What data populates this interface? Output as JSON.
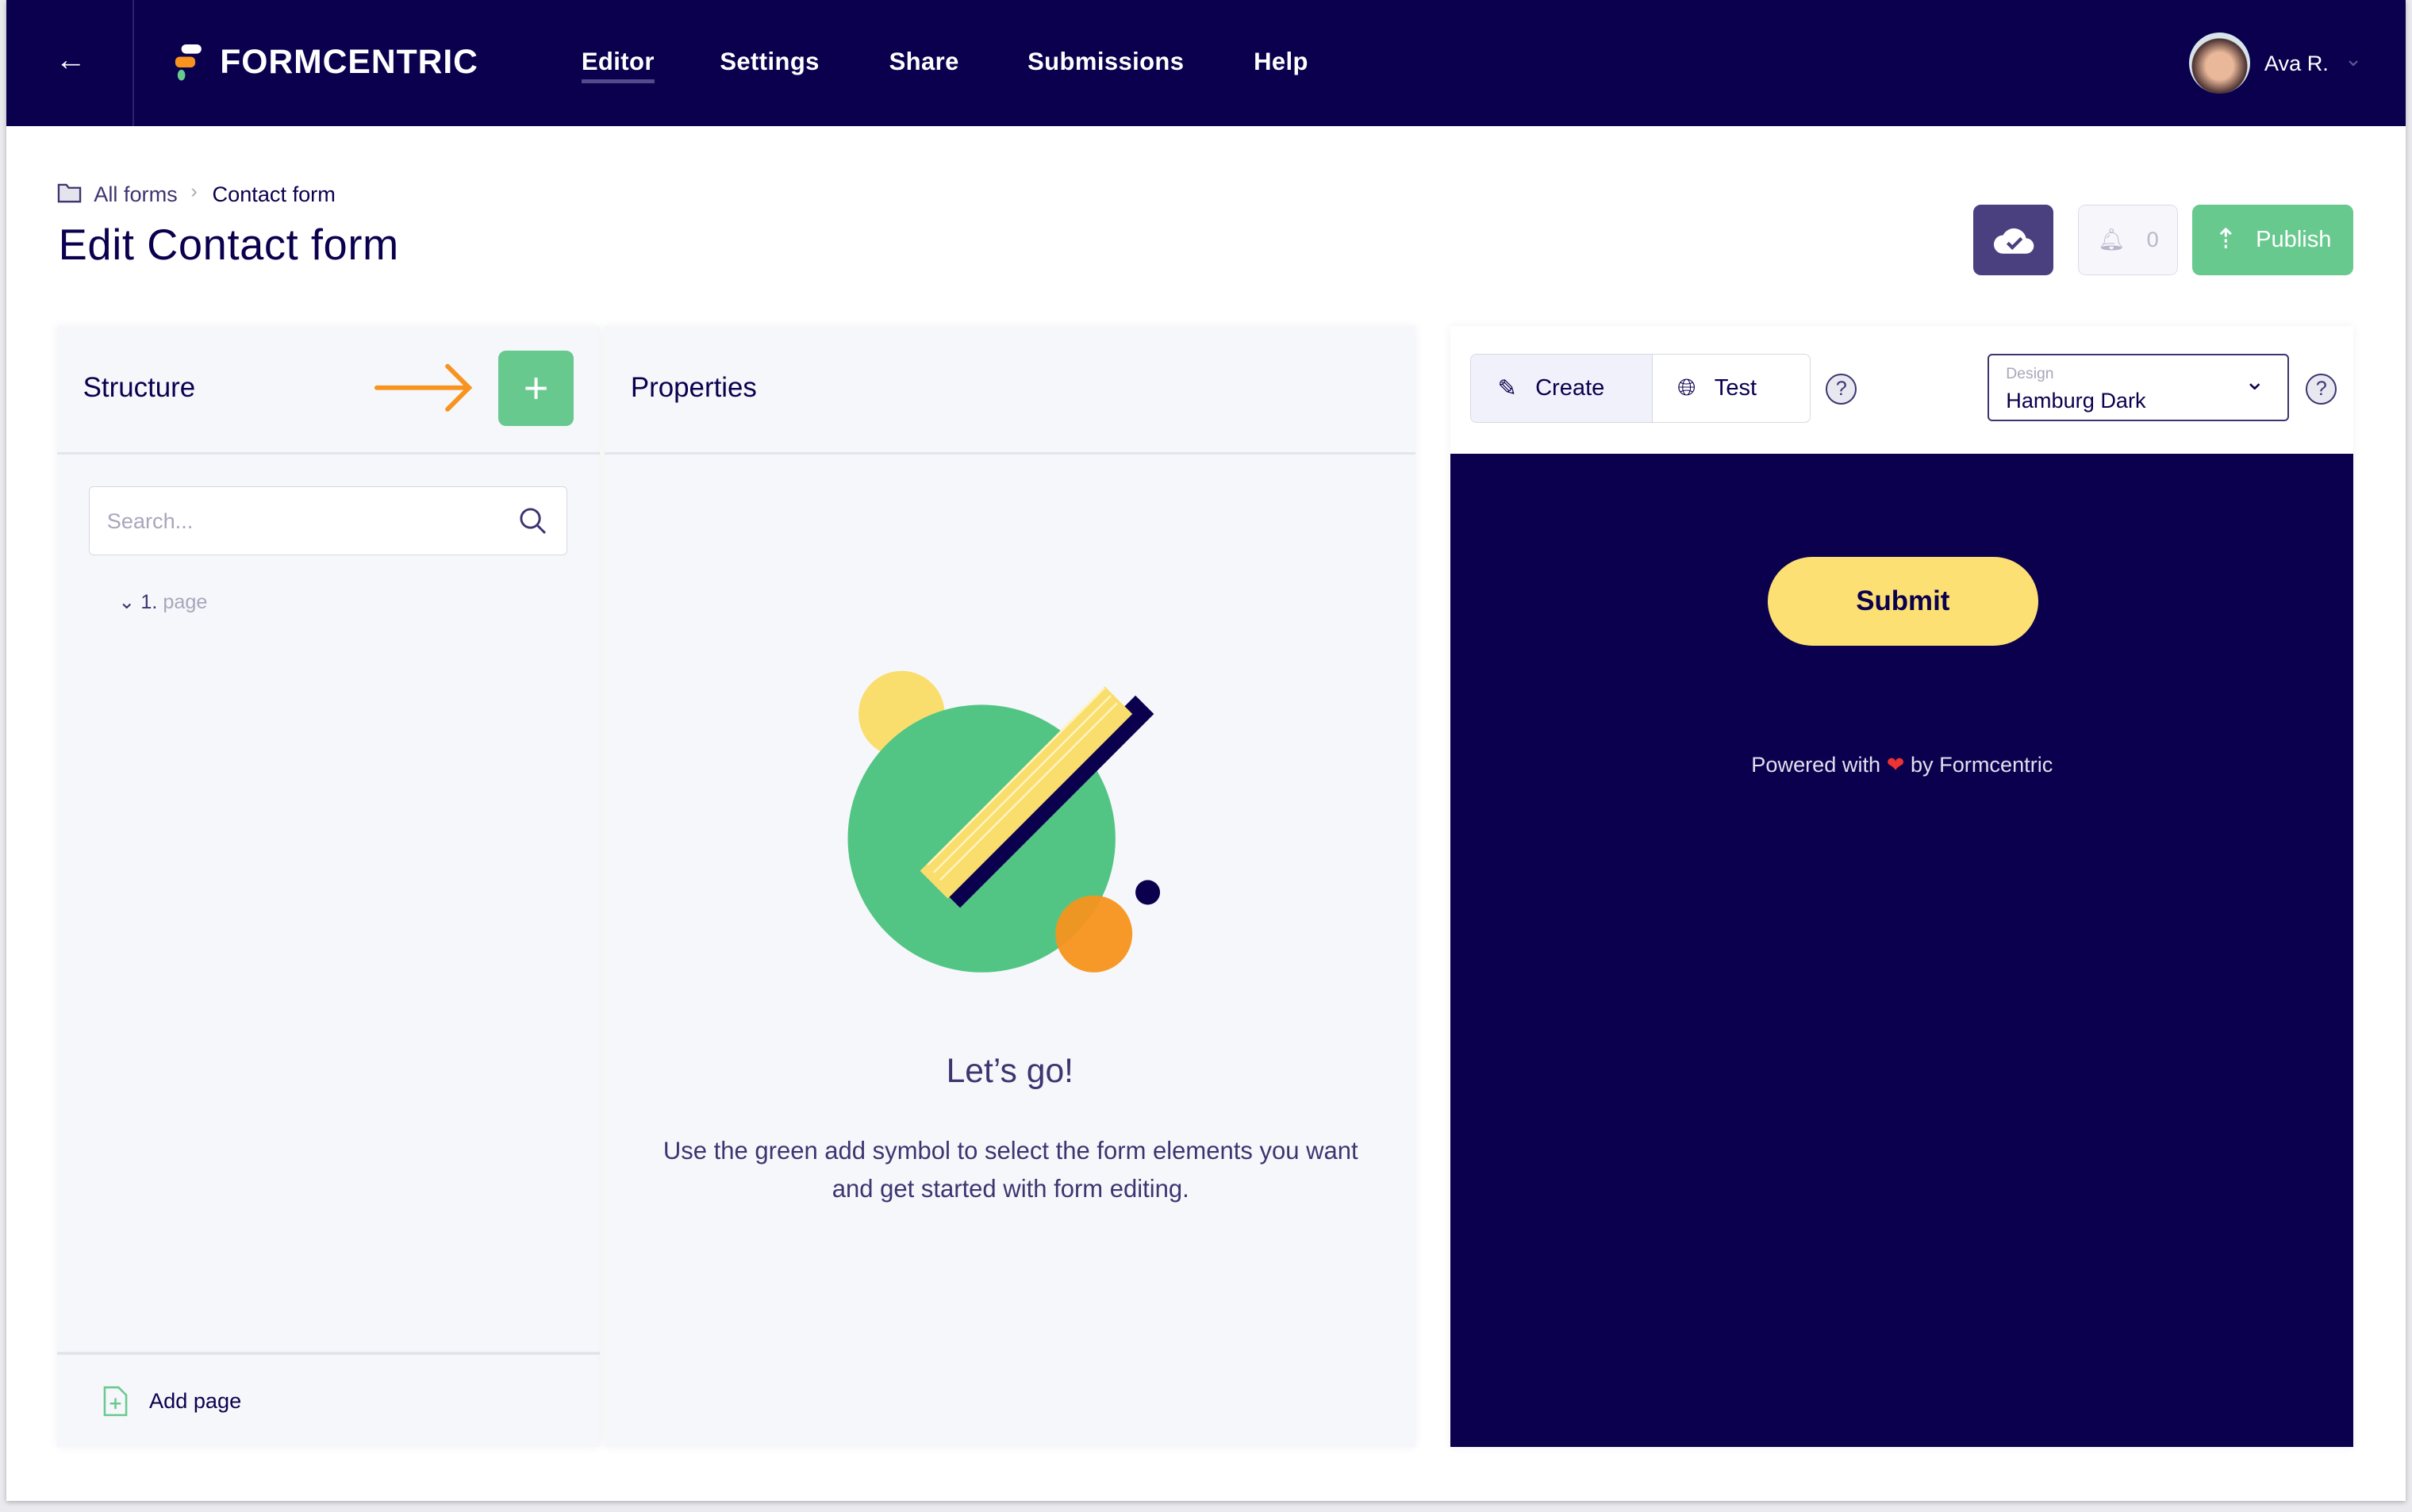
{
  "header": {
    "brand": "FORMCENTRIC",
    "nav": [
      {
        "label": "Editor",
        "active": true
      },
      {
        "label": "Settings"
      },
      {
        "label": "Share"
      },
      {
        "label": "Submissions"
      },
      {
        "label": "Help"
      }
    ],
    "user": "Ava R."
  },
  "breadcrumb": {
    "root": "All forms",
    "current": "Contact form"
  },
  "page_title": "Edit Contact form",
  "toolbar": {
    "notifications": "0",
    "publish": "Publish"
  },
  "structure": {
    "title": "Structure",
    "search_placeholder": "Search...",
    "tree": [
      {
        "num": "1.",
        "label": "page"
      }
    ],
    "add_page": "Add page"
  },
  "properties": {
    "title": "Properties",
    "empty_title": "Let’s go!",
    "empty_text": "Use the green add symbol to select the form elements you want and get started with form editing."
  },
  "preview": {
    "create": "Create",
    "test": "Test",
    "design_label": "Design",
    "design_value": "Hamburg Dark",
    "submit": "Submit",
    "powered_pre": "Powered with",
    "powered_post": "by Formcentric"
  },
  "colors": {
    "navy": "#0b004e",
    "green": "#68c98f",
    "yellow": "#fde073",
    "orange": "#f7931e",
    "purple": "#4a3f7f"
  }
}
